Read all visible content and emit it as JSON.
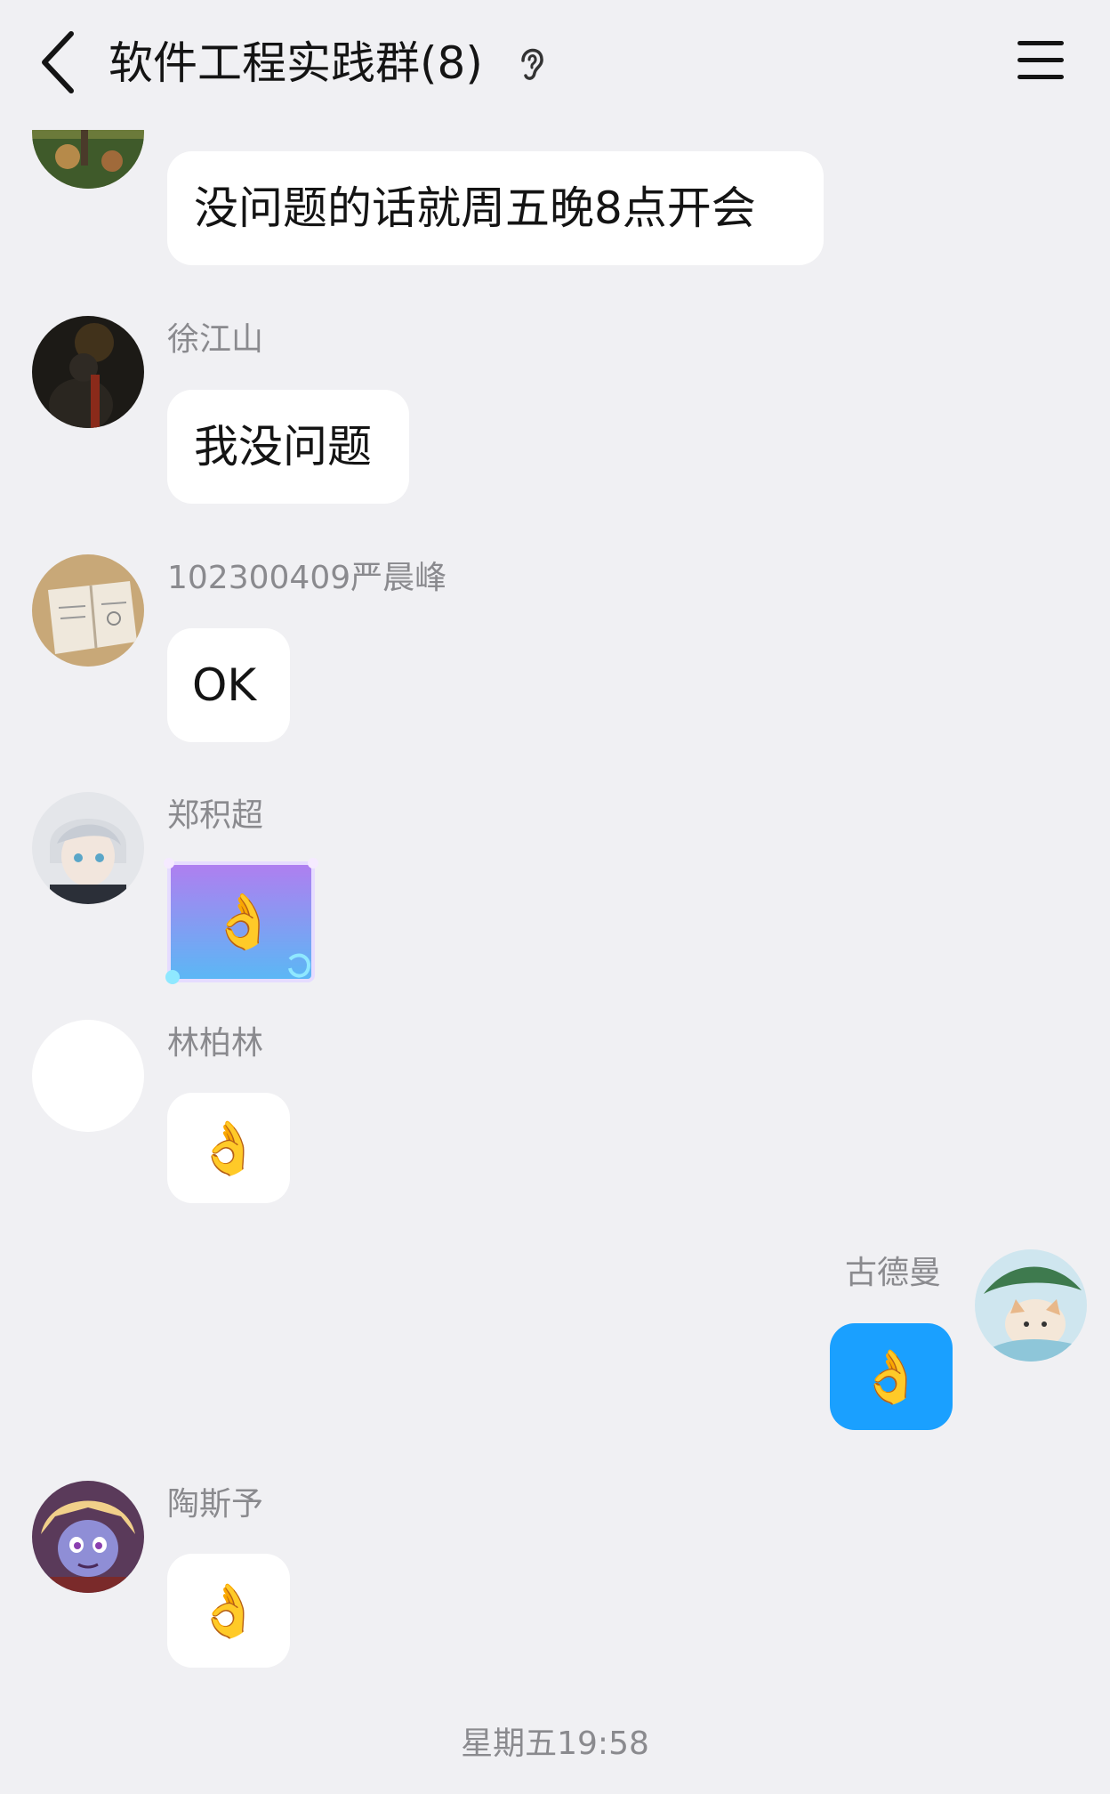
{
  "header": {
    "title": "软件工程实践群(8)"
  },
  "messages": [
    {
      "text": "没问题的话就周五晚8点开会"
    },
    {
      "sender": "徐江山",
      "text": "我没问题"
    },
    {
      "sender": "102300409严晨峰",
      "text": "OK"
    },
    {
      "sender": "郑积超",
      "sticker": "👌"
    },
    {
      "sender": "林柏林",
      "emoji": "👌"
    },
    {
      "sender": "古德曼",
      "emoji": "👌",
      "self": true,
      "bubble_color": "#1aa0ff"
    },
    {
      "sender": "陶斯予",
      "emoji": "👌"
    }
  ],
  "timestamp": "星期五19:58",
  "colors": {
    "background": "#f0f0f3",
    "bubble_incoming": "#ffffff",
    "bubble_outgoing": "#1aa0ff",
    "meta_text": "#8a8a8e"
  }
}
